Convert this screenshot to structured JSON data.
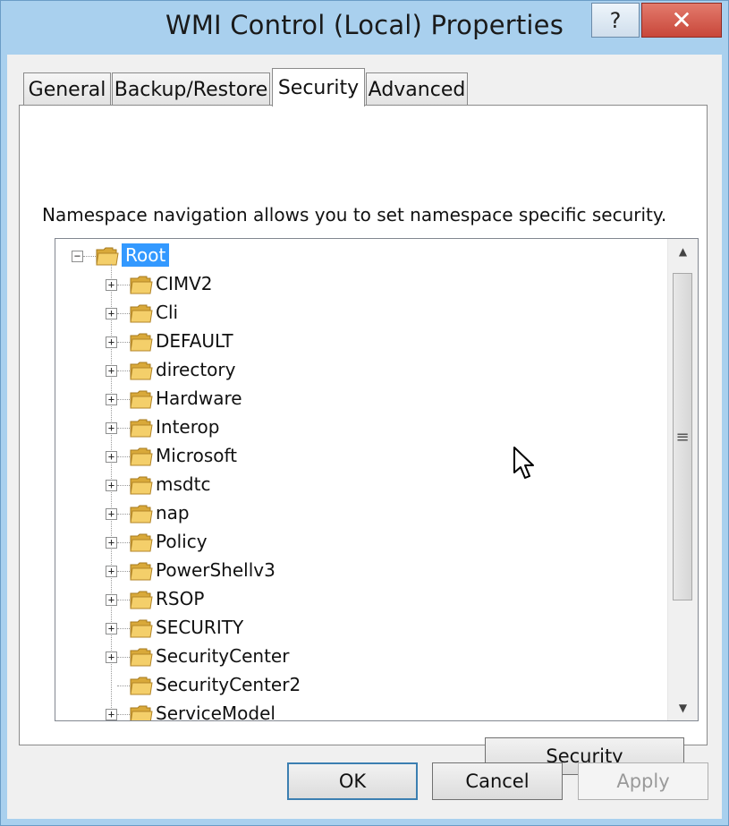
{
  "window": {
    "title": "WMI Control (Local) Properties",
    "help_label": "?",
    "close_label": "✕"
  },
  "tabs": [
    {
      "label": "General"
    },
    {
      "label": "Backup/Restore"
    },
    {
      "label": "Security",
      "active": true
    },
    {
      "label": "Advanced"
    }
  ],
  "panel": {
    "description": "Namespace navigation allows you to set namespace specific security."
  },
  "tree": {
    "root": {
      "label": "Root",
      "expander": "−",
      "selected": true
    },
    "children": [
      {
        "label": "CIMV2",
        "expander": "+"
      },
      {
        "label": "Cli",
        "expander": "+"
      },
      {
        "label": "DEFAULT",
        "expander": "+"
      },
      {
        "label": "directory",
        "expander": "+"
      },
      {
        "label": "Hardware",
        "expander": "+"
      },
      {
        "label": "Interop",
        "expander": "+"
      },
      {
        "label": "Microsoft",
        "expander": "+"
      },
      {
        "label": "msdtc",
        "expander": "+"
      },
      {
        "label": "nap",
        "expander": "+"
      },
      {
        "label": "Policy",
        "expander": "+"
      },
      {
        "label": "PowerShellv3",
        "expander": "+"
      },
      {
        "label": "RSOP",
        "expander": "+"
      },
      {
        "label": "SECURITY",
        "expander": "+"
      },
      {
        "label": "SecurityCenter",
        "expander": "+"
      },
      {
        "label": "SecurityCenter2",
        "expander": ""
      },
      {
        "label": "ServiceModel",
        "expander": "+"
      }
    ],
    "scroll_up_glyph": "▲",
    "scroll_down_glyph": "▼",
    "thumb_grip": "≡"
  },
  "buttons": {
    "security": "Security",
    "ok": "OK",
    "cancel": "Cancel",
    "apply": "Apply"
  },
  "colors": {
    "selection": "#3399ff",
    "title_bar": "#a9d0ee",
    "close_button": "#c8473a"
  }
}
